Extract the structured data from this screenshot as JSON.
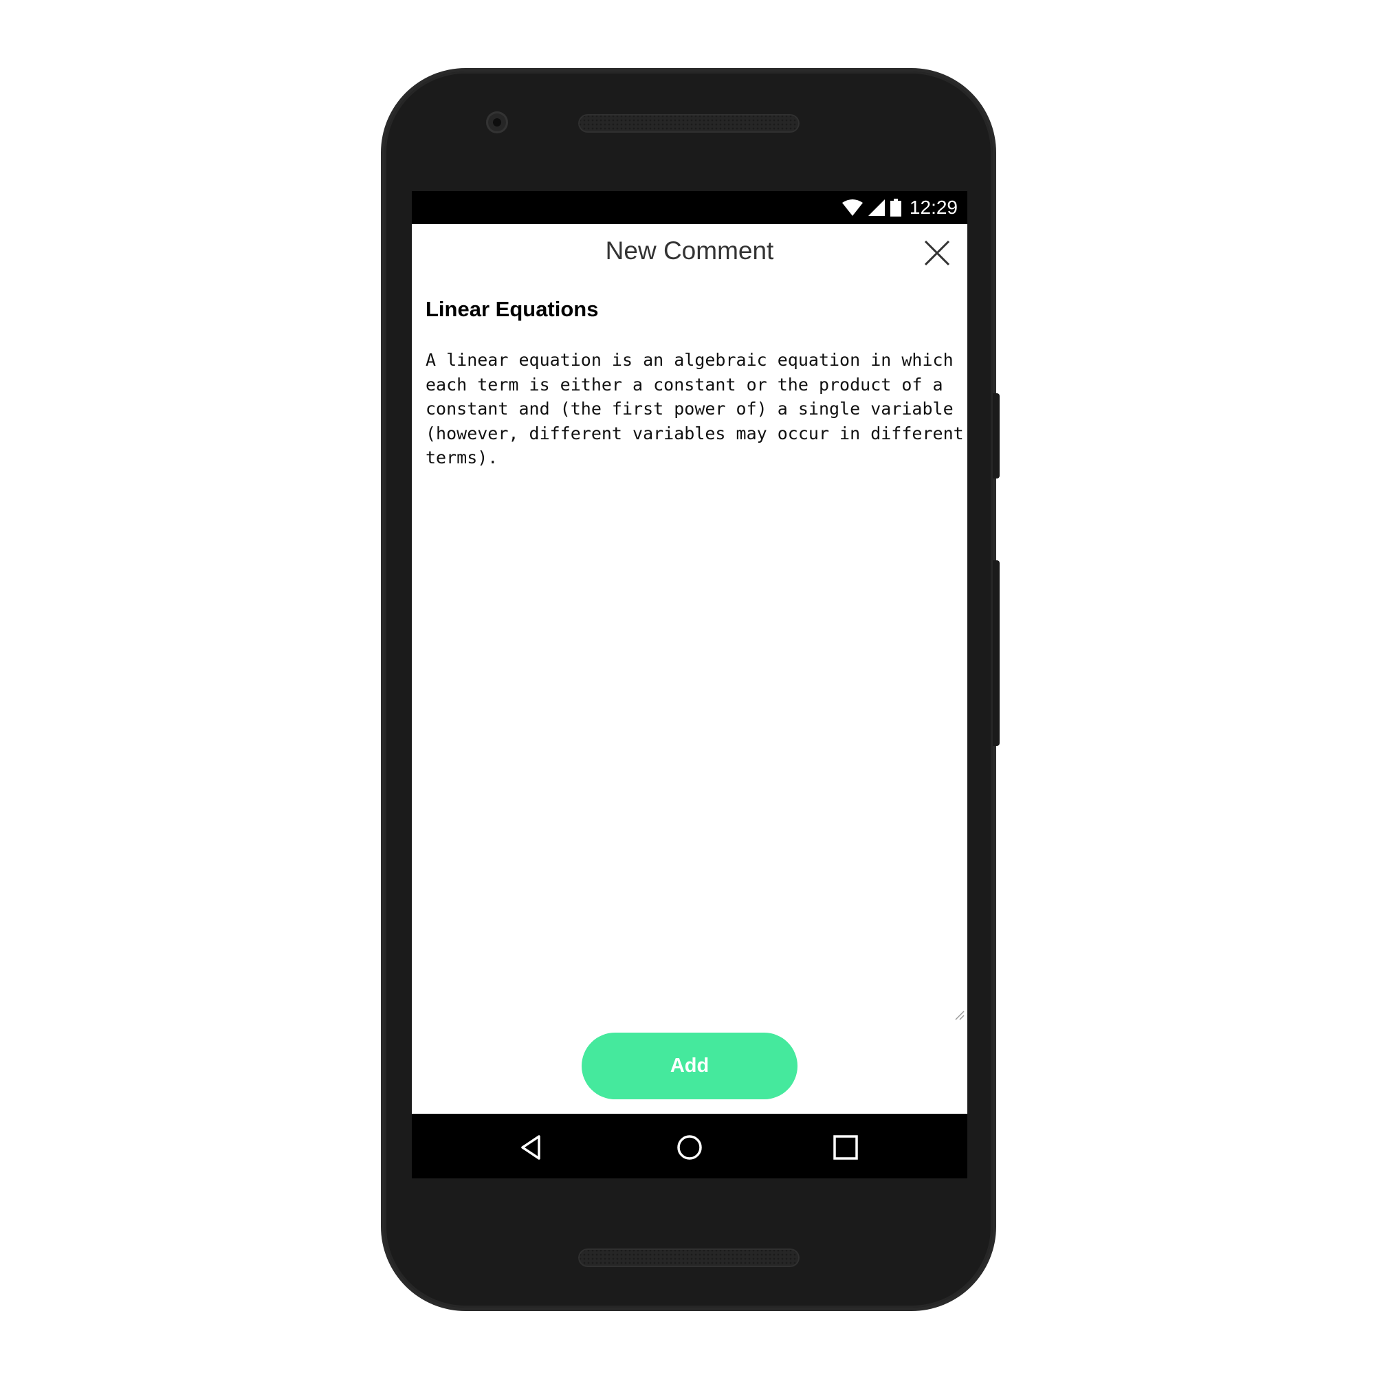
{
  "status_bar": {
    "time": "12:29",
    "icons": [
      "wifi-icon",
      "signal-icon",
      "battery-icon"
    ],
    "background": "#000000"
  },
  "dialog": {
    "title": "New Comment",
    "close_icon": "close-icon"
  },
  "section": {
    "title": "Linear Equations"
  },
  "comment": {
    "value": "A linear equation is an algebraic equation in which each term is either a constant or the product of a constant and (the first power of) a single variable (however, different variables may occur in different terms).",
    "placeholder": ""
  },
  "actions": {
    "add_label": "Add",
    "add_color": "#45e99d"
  },
  "nav_bar": {
    "icons": [
      "back-icon",
      "home-icon",
      "recents-icon"
    ]
  },
  "device": {
    "body_color": "#1b1b1b"
  }
}
